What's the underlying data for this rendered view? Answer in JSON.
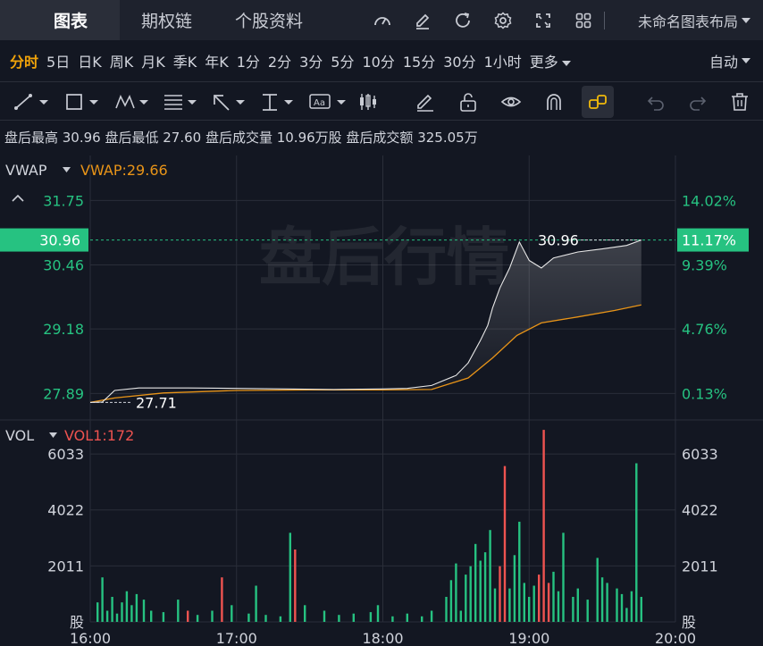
{
  "header": {
    "tabs": [
      {
        "label": "图表",
        "active": true
      },
      {
        "label": "期权链",
        "active": false
      },
      {
        "label": "个股资料",
        "active": false
      }
    ],
    "icons": [
      "gauge-icon",
      "edit-icon",
      "refresh-icon",
      "settings-icon",
      "fullscreen-icon",
      "grid-icon"
    ],
    "layout_name": "未命名图表布局"
  },
  "periods": {
    "items": [
      "分时",
      "5日",
      "日K",
      "周K",
      "月K",
      "季K",
      "年K",
      "1分",
      "2分",
      "3分",
      "5分",
      "10分",
      "15分",
      "30分",
      "1小时",
      "更多"
    ],
    "active": "分时",
    "mode": "自动"
  },
  "tools": [
    "line-tool-icon",
    "rect-tool-icon",
    "pattern-tool-icon",
    "fib-tool-icon",
    "arrow-tool-icon",
    "measure-tool-icon",
    "text-tool-icon",
    "candle-tool-icon",
    "pencil-icon",
    "lock-icon",
    "eye-icon",
    "magnet-icon",
    "link-icon",
    "undo-icon",
    "redo-icon",
    "trash-icon"
  ],
  "info": {
    "text": "盘后最高 30.96 盘后最低 27.60 盘后成交量 10.96万股 盘后成交额 325.05万"
  },
  "price_panel": {
    "indicator_name": "VWAP",
    "indicator_value": "VWAP:29.66",
    "watermark": "盘后行情",
    "current_price": "30.96",
    "current_pct": "11.17%",
    "high_label": "30.96",
    "low_label": "27.71",
    "colors": {
      "up": "#26c281",
      "price_line": "#e8e8e8",
      "vwap": "#e89418",
      "badge": "#26c281"
    }
  },
  "vol_panel": {
    "indicator_name": "VOL",
    "indicator_value": "VOL1:172",
    "unit": "股",
    "colors": {
      "up": "#ef5350",
      "down": "#26c281"
    }
  },
  "chart_data": [
    {
      "type": "line",
      "panel": "price",
      "x_axis": {
        "ticks": [
          "16:00",
          "17:00",
          "18:00",
          "19:00",
          "20:00"
        ],
        "range": [
          "16:00",
          "20:00"
        ]
      },
      "y_axis_left": {
        "ticks": [
          27.89,
          29.18,
          30.46,
          31.75
        ],
        "range": [
          27.36,
          32.65
        ]
      },
      "y_axis_right": {
        "ticks": [
          "0.13%",
          "4.76%",
          "9.39%",
          "14.02%"
        ]
      },
      "series": [
        {
          "role": "price",
          "points": [
            [
              "16:00",
              27.71
            ],
            [
              "16:05",
              27.72
            ],
            [
              "16:10",
              27.95
            ],
            [
              "16:20",
              28.0
            ],
            [
              "16:40",
              28.0
            ],
            [
              "17:00",
              27.99
            ],
            [
              "17:20",
              27.98
            ],
            [
              "17:40",
              27.97
            ],
            [
              "18:00",
              27.98
            ],
            [
              "18:10",
              27.99
            ],
            [
              "18:20",
              28.05
            ],
            [
              "18:30",
              28.25
            ],
            [
              "18:35",
              28.5
            ],
            [
              "18:40",
              28.95
            ],
            [
              "18:43",
              29.25
            ],
            [
              "18:45",
              29.6
            ],
            [
              "18:48",
              30.0
            ],
            [
              "18:52",
              30.4
            ],
            [
              "18:56",
              30.92
            ],
            [
              "19:00",
              30.55
            ],
            [
              "19:05",
              30.4
            ],
            [
              "19:10",
              30.6
            ],
            [
              "19:20",
              30.72
            ],
            [
              "19:30",
              30.78
            ],
            [
              "19:40",
              30.85
            ],
            [
              "19:46",
              30.96
            ]
          ]
        },
        {
          "role": "vwap",
          "points": [
            [
              "16:00",
              27.71
            ],
            [
              "16:10",
              27.8
            ],
            [
              "16:30",
              27.9
            ],
            [
              "17:00",
              27.95
            ],
            [
              "17:30",
              27.96
            ],
            [
              "18:00",
              27.96
            ],
            [
              "18:20",
              27.97
            ],
            [
              "18:35",
              28.2
            ],
            [
              "18:45",
              28.6
            ],
            [
              "18:55",
              29.05
            ],
            [
              "19:05",
              29.3
            ],
            [
              "19:20",
              29.42
            ],
            [
              "19:35",
              29.55
            ],
            [
              "19:46",
              29.66
            ]
          ]
        }
      ]
    },
    {
      "type": "bar",
      "panel": "volume",
      "x_axis": {
        "ticks": [
          "16:00",
          "17:00",
          "18:00",
          "19:00",
          "20:00"
        ]
      },
      "y_axis": {
        "ticks": [
          2011,
          4022,
          6033
        ],
        "range": [
          0,
          7000
        ]
      },
      "series": [
        {
          "name": "VOL",
          "bars": [
            [
              "16:03",
              700,
              "down"
            ],
            [
              "16:05",
              1600,
              "down"
            ],
            [
              "16:07",
              400,
              "down"
            ],
            [
              "16:09",
              900,
              "down"
            ],
            [
              "16:11",
              300,
              "down"
            ],
            [
              "16:13",
              700,
              "down"
            ],
            [
              "16:15",
              1100,
              "down"
            ],
            [
              "16:17",
              600,
              "down"
            ],
            [
              "16:19",
              1000,
              "down"
            ],
            [
              "16:22",
              800,
              "down"
            ],
            [
              "16:25",
              400,
              "down"
            ],
            [
              "16:30",
              350,
              "down"
            ],
            [
              "16:36",
              800,
              "down"
            ],
            [
              "16:40",
              400,
              "up"
            ],
            [
              "16:44",
              250,
              "down"
            ],
            [
              "16:50",
              400,
              "down"
            ],
            [
              "16:54",
              1600,
              "up"
            ],
            [
              "16:58",
              600,
              "down"
            ],
            [
              "17:05",
              300,
              "down"
            ],
            [
              "17:08",
              1300,
              "down"
            ],
            [
              "17:12",
              250,
              "down"
            ],
            [
              "17:18",
              200,
              "down"
            ],
            [
              "17:22",
              3200,
              "down"
            ],
            [
              "17:24",
              2600,
              "up"
            ],
            [
              "17:28",
              600,
              "down"
            ],
            [
              "17:36",
              400,
              "down"
            ],
            [
              "17:42",
              250,
              "down"
            ],
            [
              "17:48",
              300,
              "down"
            ],
            [
              "17:55",
              350,
              "down"
            ],
            [
              "17:58",
              600,
              "down"
            ],
            [
              "18:04",
              200,
              "down"
            ],
            [
              "18:10",
              300,
              "down"
            ],
            [
              "18:16",
              200,
              "down"
            ],
            [
              "18:20",
              400,
              "down"
            ],
            [
              "18:26",
              900,
              "down"
            ],
            [
              "18:28",
              1500,
              "down"
            ],
            [
              "18:30",
              2100,
              "down"
            ],
            [
              "18:32",
              400,
              "down"
            ],
            [
              "18:34",
              1700,
              "down"
            ],
            [
              "18:36",
              2000,
              "down"
            ],
            [
              "18:38",
              2800,
              "down"
            ],
            [
              "18:40",
              2200,
              "down"
            ],
            [
              "18:42",
              2500,
              "down"
            ],
            [
              "18:44",
              3300,
              "down"
            ],
            [
              "18:46",
              1200,
              "down"
            ],
            [
              "18:48",
              2000,
              "up"
            ],
            [
              "18:50",
              5600,
              "up"
            ],
            [
              "18:52",
              1200,
              "down"
            ],
            [
              "18:54",
              2400,
              "down"
            ],
            [
              "18:56",
              3600,
              "down"
            ],
            [
              "18:58",
              1400,
              "down"
            ],
            [
              "19:00",
              900,
              "down"
            ],
            [
              "19:02",
              1300,
              "down"
            ],
            [
              "19:04",
              1700,
              "up"
            ],
            [
              "19:06",
              6900,
              "up"
            ],
            [
              "19:08",
              1400,
              "up"
            ],
            [
              "19:10",
              1800,
              "down"
            ],
            [
              "19:12",
              1100,
              "down"
            ],
            [
              "19:14",
              3200,
              "down"
            ],
            [
              "19:18",
              900,
              "down"
            ],
            [
              "19:20",
              1200,
              "down"
            ],
            [
              "19:24",
              800,
              "down"
            ],
            [
              "19:28",
              2300,
              "down"
            ],
            [
              "19:30",
              1600,
              "down"
            ],
            [
              "19:32",
              1400,
              "down"
            ],
            [
              "19:36",
              1200,
              "down"
            ],
            [
              "19:38",
              1000,
              "down"
            ],
            [
              "19:40",
              500,
              "down"
            ],
            [
              "19:42",
              1100,
              "down"
            ],
            [
              "19:44",
              5700,
              "down"
            ],
            [
              "19:46",
              900,
              "down"
            ]
          ]
        }
      ]
    }
  ]
}
